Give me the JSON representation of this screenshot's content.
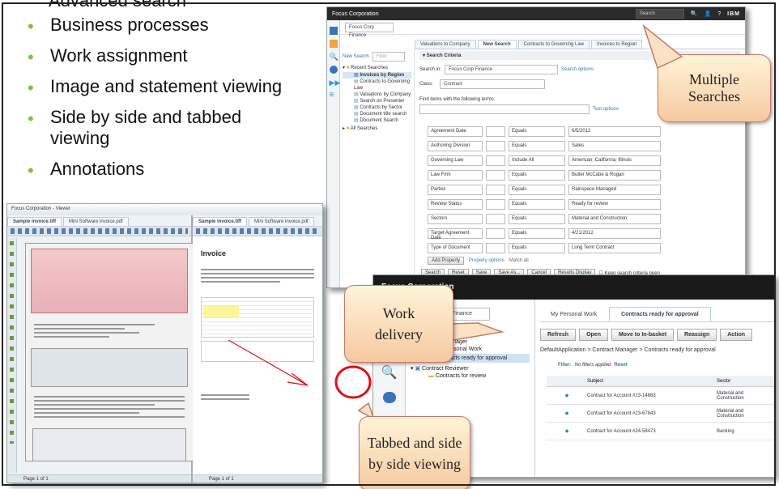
{
  "bullets": [
    {
      "text": "Advanced search",
      "sub": true
    },
    {
      "text": "Business processes"
    },
    {
      "text": "Work assignment"
    },
    {
      "text": "Image and statement viewing"
    },
    {
      "text": "Side by side and tabbed viewing"
    },
    {
      "text": "Annotations"
    }
  ],
  "callouts": {
    "searches": "Multiple Searches",
    "delivery": "Work delivery",
    "viewing": "Tabbed and side by side viewing"
  },
  "search_win": {
    "title": "Focus Corporation",
    "search_placeholder": "Search",
    "brand": "IBM",
    "app_select": "Focus Corp Finance",
    "tabs": [
      "Valuations to Company",
      "New Search",
      "Contracts to Governing Law",
      "Invoices to Region"
    ],
    "new_search": "New Search",
    "filter_placeholder": "Filter",
    "tree_root": "Recent Searches",
    "tree_items": [
      "Invoices by Region",
      "Contracts to Governing Law",
      "Valuations by Company",
      "Search on Presenter",
      "Contracts by Sector",
      "Document title search",
      "Document Search"
    ],
    "tree_all": "All Searches",
    "criteria_header": "Search Criteria",
    "search_in_label": "Search in:",
    "search_in_value": "Focus Corp Finance",
    "search_options": "Search options",
    "class_label": "Class:",
    "class_value": "Contract",
    "find_label": "Find items with the following terms:",
    "text_options": "Text options",
    "criteria": [
      {
        "field": "Agreement Date",
        "op": "Equals",
        "value": "6/5/2012"
      },
      {
        "field": "Authoring Division",
        "op": "Equals",
        "value": "Sales"
      },
      {
        "field": "Governing Law",
        "op": "Include All",
        "value": "American; California; Illinois"
      },
      {
        "field": "Law Firm",
        "op": "Equals",
        "value": "Butler McCabe & Rogan"
      },
      {
        "field": "Parties",
        "op": "Equals",
        "value": "Rainspace Managed"
      },
      {
        "field": "Review Status",
        "op": "Equals",
        "value": "Ready for review"
      },
      {
        "field": "Sectors",
        "op": "Equals",
        "value": "Material and Construction"
      },
      {
        "field": "Target Agreement Date",
        "op": "Equals",
        "value": "4/21/2012"
      },
      {
        "field": "Type of Document",
        "op": "Equals",
        "value": "Long Term Contract"
      }
    ],
    "add_property": "Add Property",
    "property_options": "Property options",
    "match_all": "Match all",
    "actions": [
      "Search",
      "Reset",
      "Save",
      "Save As...",
      "Cancel",
      "Results Display"
    ],
    "keep_open": "Keep search criteria open"
  },
  "viewer_win": {
    "title": "Focus Corporation - Viewer",
    "tabs_left": [
      "Sample invoice.tiff",
      "Mini Software invoice.pdf"
    ],
    "tabs_right": [
      "Sample invoice.tiff",
      "Mini Software invoice.pdf"
    ],
    "invoice_title": "Invoice",
    "page_label": "Page 1 of 1"
  },
  "work_win": {
    "title": "Focus Corporation",
    "app_select": "Focus Corp Finance",
    "tabs": [
      "My Personal Work",
      "Contracts ready for approval"
    ],
    "tree": [
      {
        "label": "Contract Manager",
        "children": [
          "My Personal Work",
          "Contracts ready for approval"
        ]
      },
      {
        "label": "Contract Reviewer",
        "children": [
          "Contracts for review"
        ]
      }
    ],
    "toolbar": [
      "Refresh",
      "Open",
      "Move to In-basket",
      "Reassign",
      "Action"
    ],
    "breadcrumb": "DefaultApplication > Contract Manager > Contracts ready for approval",
    "filter_label": "Filter:",
    "filter_value": "No filters applied",
    "reset": "Reset",
    "columns": [
      "Subject",
      "Sector"
    ],
    "rows": [
      {
        "subject": "Contract for Account #23-14683",
        "sector": "Material and Construction"
      },
      {
        "subject": "Contract for Account #23-67843",
        "sector": "Material and Construction"
      },
      {
        "subject": "Contract for Account #24-58473",
        "sector": "Banking"
      }
    ]
  },
  "colors": {
    "bullet": "#7cc242",
    "accent": "#3b73b9",
    "callout_border": "#cc7766",
    "circle": "#e01010"
  }
}
